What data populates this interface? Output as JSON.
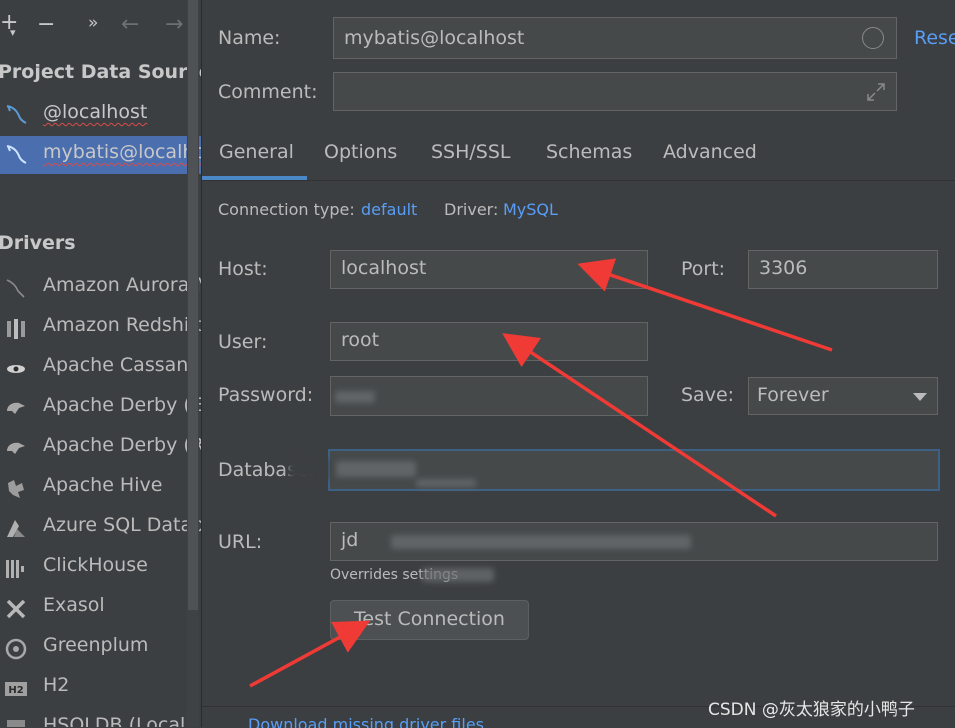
{
  "toolbar": {
    "add_label": "+",
    "add_chevron": "▾",
    "remove_label": "−",
    "more_label": "»",
    "back_label": "←",
    "forward_label": "→"
  },
  "sidebar": {
    "project_title": "Project Data Sources",
    "data_sources": [
      {
        "label": "@localhost",
        "icon": "mysql-dolphin-icon",
        "selected": false
      },
      {
        "label": "mybatis@localhost",
        "icon": "mysql-dolphin-icon",
        "selected": true
      }
    ],
    "drivers_title": "Drivers",
    "drivers": [
      {
        "label": "Amazon Aurora MySQL",
        "icon": "aurora-icon"
      },
      {
        "label": "Amazon Redshift",
        "icon": "redshift-icon"
      },
      {
        "label": "Apache Cassandra",
        "icon": "cassandra-icon"
      },
      {
        "label": "Apache Derby (Embedded)",
        "icon": "derby-icon"
      },
      {
        "label": "Apache Derby (Remote)",
        "icon": "derby-icon"
      },
      {
        "label": "Apache Hive",
        "icon": "hive-icon"
      },
      {
        "label": "Azure SQL Database",
        "icon": "azure-icon"
      },
      {
        "label": "ClickHouse",
        "icon": "clickhouse-icon"
      },
      {
        "label": "Exasol",
        "icon": "exasol-icon"
      },
      {
        "label": "Greenplum",
        "icon": "greenplum-icon"
      },
      {
        "label": "H2",
        "icon": "h2-icon"
      },
      {
        "label": "HSQLDB (Local)",
        "icon": "hsqldb-icon"
      }
    ]
  },
  "form": {
    "name_label": "Name:",
    "name_value": "mybatis@localhost",
    "reset_label": "Reset",
    "comment_label": "Comment:",
    "comment_value": "",
    "tabs": [
      "General",
      "Options",
      "SSH/SSL",
      "Schemas",
      "Advanced"
    ],
    "active_tab": "General",
    "connection_type_label": "Connection type:",
    "connection_type_value": "default",
    "driver_label": "Driver:",
    "driver_value": "MySQL",
    "host_label": "Host:",
    "host_value": "localhost",
    "port_label": "Port:",
    "port_value": "3306",
    "user_label": "User:",
    "user_value": "root",
    "password_label": "Password:",
    "save_label": "Save:",
    "save_value": "Forever",
    "database_label": "Database:",
    "url_label": "URL:",
    "url_value": "jd",
    "overrides_note": "Overrides settings",
    "test_button": "Test Connection",
    "bottom_link": "Download missing driver files"
  },
  "watermark": "CSDN @灰太狼家的小鸭子",
  "colors": {
    "accent": "#4a88c7",
    "link": "#589df6",
    "selection": "#4b6eaf",
    "annotation_arrow": "#f03a35"
  }
}
